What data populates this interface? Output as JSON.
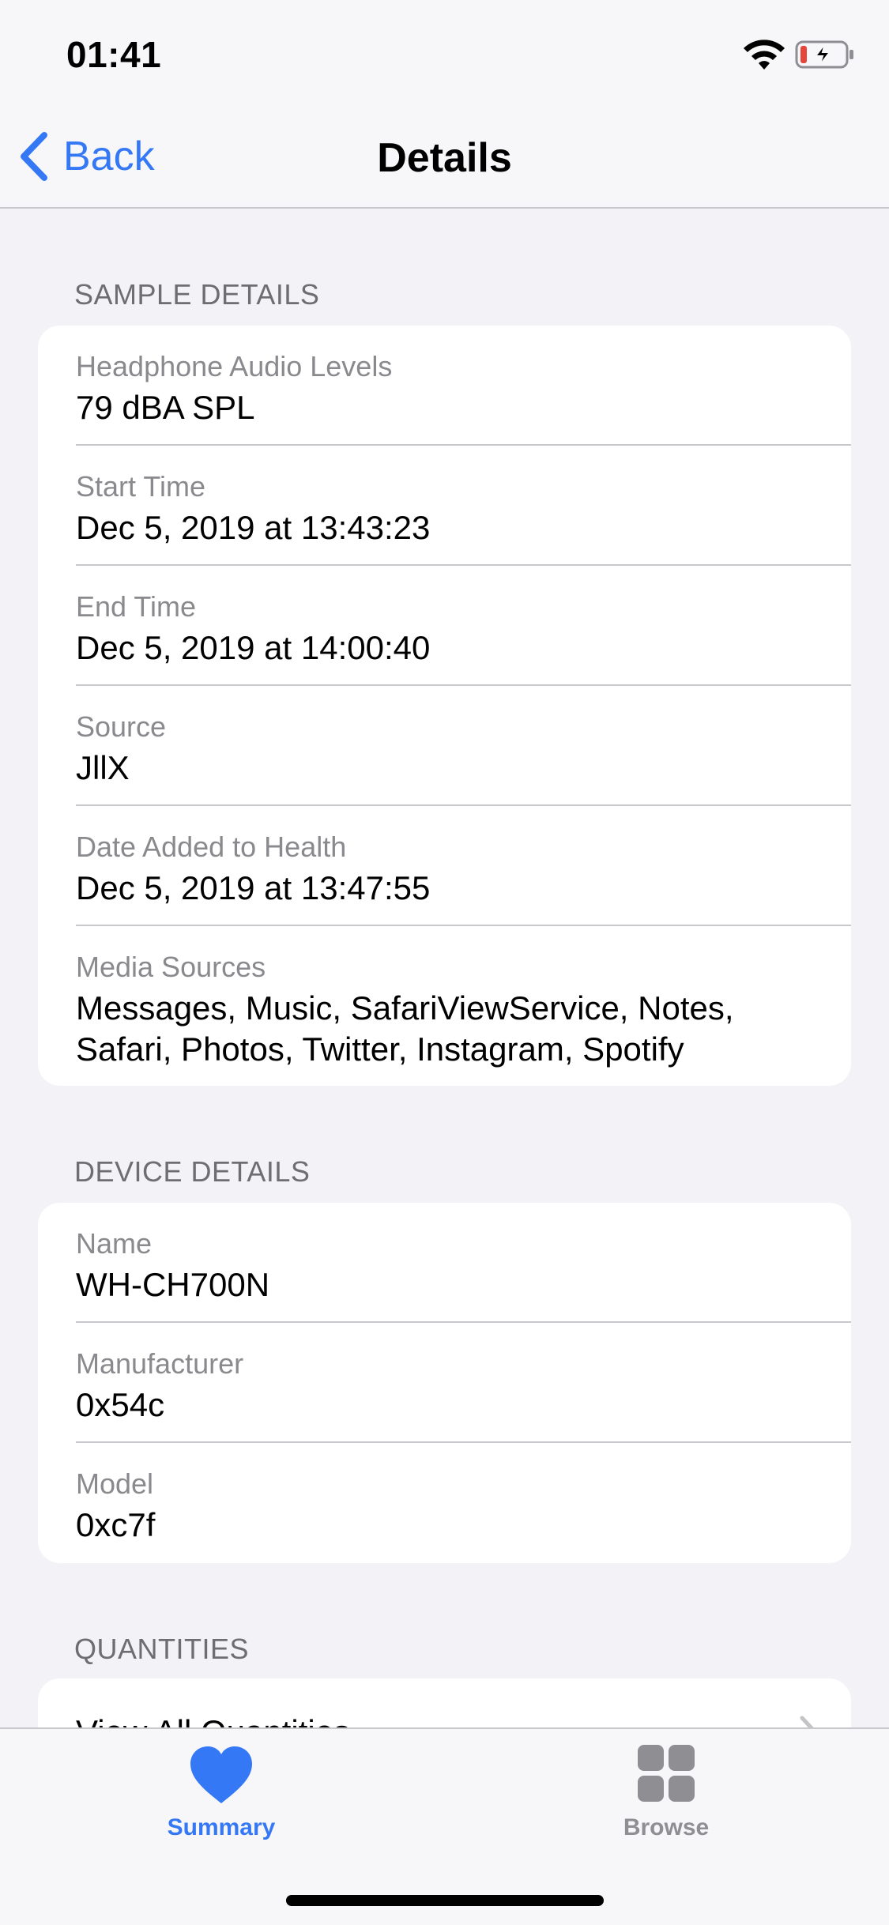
{
  "status_bar": {
    "time": "01:41"
  },
  "nav": {
    "back_label": "Back",
    "title": "Details"
  },
  "sample_details": {
    "header": "SAMPLE DETAILS",
    "rows": [
      {
        "label": "Headphone Audio Levels",
        "value": "79 dBA SPL"
      },
      {
        "label": "Start Time",
        "value": "Dec 5, 2019 at 13:43:23"
      },
      {
        "label": "End Time",
        "value": "Dec 5, 2019 at 14:00:40"
      },
      {
        "label": "Source",
        "value": "JllX"
      },
      {
        "label": "Date Added to Health",
        "value": "Dec 5, 2019 at 13:47:55"
      },
      {
        "label": "Media Sources",
        "value": "Messages, Music, SafariViewService, Notes, Safari, Photos, Twitter, Instagram, Spotify"
      }
    ]
  },
  "device_details": {
    "header": "DEVICE DETAILS",
    "rows": [
      {
        "label": "Name",
        "value": "WH-CH700N"
      },
      {
        "label": "Manufacturer",
        "value": "0x54c"
      },
      {
        "label": "Model",
        "value": "0xc7f"
      }
    ]
  },
  "quantities": {
    "header": "QUANTITIES",
    "view_all_label": "View All Quantities"
  },
  "tab_bar": {
    "summary_label": "Summary",
    "browse_label": "Browse"
  },
  "colors": {
    "accent": "#3478f6",
    "background": "#f2f2f7",
    "inactive_tab": "#8e8e93",
    "battery_low": "#e5453a"
  },
  "icons": {
    "back": "chevron-left-icon",
    "wifi": "wifi-icon",
    "battery": "battery-charging-icon",
    "summary": "heart-icon",
    "browse": "grid-icon",
    "disclosure": "chevron-right-icon"
  }
}
